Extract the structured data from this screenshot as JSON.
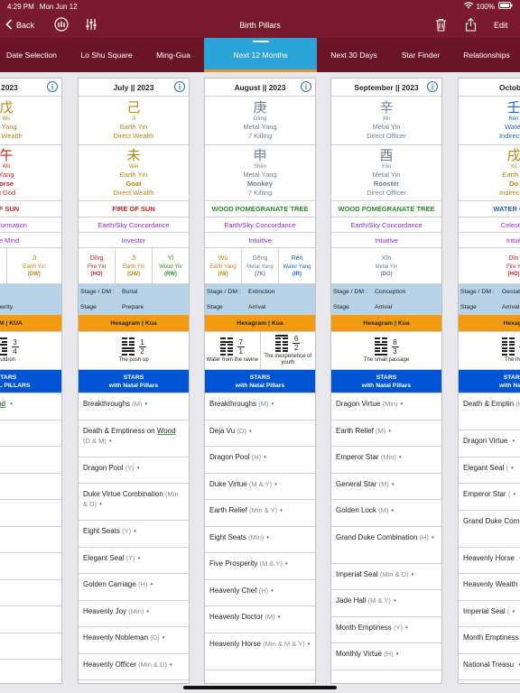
{
  "status": {
    "time": "4:29 PM",
    "date": "Mon Jun 12",
    "battery": "100%"
  },
  "nav": {
    "back": "Back",
    "title": "Birth Pillars",
    "edit": "Edit"
  },
  "tabs": [
    {
      "label": "Date Selection",
      "active": false
    },
    {
      "label": "Lo Shu Square",
      "active": false
    },
    {
      "label": "Ming-Gua",
      "active": false
    },
    {
      "label": "Next 12 Months",
      "active": true
    },
    {
      "label": "Next 30 Days",
      "active": false
    },
    {
      "label": "Star Finder",
      "active": false
    },
    {
      "label": "Relationships",
      "active": false
    }
  ],
  "colors": {
    "nav": "#7a1a2e",
    "tab_active": "#2aa3d9",
    "stage": "#b7d3ea",
    "hexagram": "#f29b10",
    "stars": "#0055d4",
    "fire": "#c81e1e",
    "earth": "#b8860b",
    "metal": "#6a7f95",
    "wood": "#2e8b2e",
    "water": "#1e63c8"
  },
  "cards": [
    {
      "month": "|| 2023",
      "stem": {
        "ch": "戊",
        "py": "Wù",
        "l1": "n Yang",
        "l2": "ect Wealth",
        "cls": "c-earth"
      },
      "branch": {
        "ch": "午",
        "py": "Wǔ",
        "l1": "Yang",
        "l2": "orse",
        "l3": "g God",
        "cls": "c-fire"
      },
      "nayin": "OF SUN",
      "nayin_cls": "c-fire",
      "rel": "ransformation",
      "trait": "ete Mind",
      "hidden": [
        {
          "py": "",
          "l1": "",
          "l2": "",
          "cls": "c-fire"
        },
        {
          "py": "Jǐ",
          "l1": "Earth Yin",
          "l2": "(DW)",
          "cls": "c-earth"
        }
      ],
      "stage": {
        "dm_k": "",
        "dm_v": "th",
        "st_k": "",
        "st_v": "sperity"
      },
      "hex_label": "RAM | KUA",
      "hexes": [
        {
          "top": [
            1,
            0,
            1
          ],
          "bot": [
            0,
            0,
            1
          ],
          "n": "3",
          "d": "4",
          "name": "auldron"
        }
      ],
      "stars_h1": "STARS",
      "stars_h2": "NATAL PILLARS",
      "stars": [
        {
          "t": "tiness on ",
          "t2": "Wood",
          "q": "",
          "two": false
        },
        {
          "t": "",
          "q": "Min)",
          "two": false
        },
        {
          "t": "",
          "q": "H)",
          "two": false
        },
        {
          "t": "",
          "q": "(Min)",
          "two": false
        },
        {
          "t": "e",
          "q": "(M)",
          "two": false
        },
        {
          "t": "",
          "q": "Min)",
          "two": false
        },
        {
          "t": "",
          "q": "(Min)",
          "two": false
        },
        {
          "t": "f",
          "q": "(M & Y)",
          "two": false
        },
        {
          "t": "se",
          "q": "(Min & D)",
          "two": false
        },
        {
          "t": "",
          "q": "(Y)",
          "two": false
        }
      ]
    },
    {
      "month": "July || 2023",
      "stem": {
        "ch": "己",
        "py": "Jǐ",
        "l1": "Earth Yin",
        "l2": "Direct Wealth",
        "cls": "c-earth"
      },
      "branch": {
        "ch": "未",
        "py": "Wèi",
        "l1": "Earth Yin",
        "l2": "Goat",
        "l3": "Direct Wealth",
        "cls": "c-earth"
      },
      "nayin": "FIRE OF SUN",
      "nayin_cls": "c-fire",
      "rel": "Earth/Sky Concordance",
      "trait": "Investor",
      "hidden": [
        {
          "py": "Dīng",
          "l1": "Fire Yin",
          "l2": "(HO)",
          "cls": "c-fire"
        },
        {
          "py": "Jǐ",
          "l1": "Earth Yin",
          "l2": "(DW)",
          "cls": "c-earth"
        },
        {
          "py": "Yǐ",
          "l1": "Wood Yin",
          "l2": "(RW)",
          "cls": "c-wood"
        }
      ],
      "stage": {
        "dm_k": "Stage / DM :",
        "dm_v": "Burial",
        "st_k": "Stage",
        "st_v": "Prepare"
      },
      "hex_label": "Hexagram | Kua",
      "hexes": [
        {
          "top": [
            0,
            0,
            0
          ],
          "bot": [
            1,
            1,
            0
          ],
          "n": "1",
          "d": "2",
          "name": "The push up"
        }
      ],
      "stars_h1": "STARS",
      "stars_h2": "with Natal Pillars",
      "stars": [
        {
          "t": "Breakthroughs",
          "q": "(M)",
          "two": false
        },
        {
          "t": "Death & Emptiness on ",
          "t2": "Wood",
          "q": "(D & M)",
          "two": true
        },
        {
          "t": "Dragon Pool",
          "q": "(Y)",
          "two": false
        },
        {
          "t": "Duke Virtue Combination",
          "q": "(Min & D)",
          "two": true
        },
        {
          "t": "Eight Seats",
          "q": "(Y)",
          "two": false
        },
        {
          "t": "Elegant Seal",
          "q": "(Y)",
          "two": false
        },
        {
          "t": "Golden Carriage",
          "q": "(H)",
          "two": false
        },
        {
          "t": "Heavenly Joy",
          "q": "(Min)",
          "two": false
        },
        {
          "t": "Heavenly Nobleman",
          "q": "(D)",
          "two": false
        },
        {
          "t": "Heavenly Officer",
          "q": "(Min & D)",
          "two": false
        }
      ]
    },
    {
      "month": "August || 2023",
      "stem": {
        "ch": "庚",
        "py": "Gēng",
        "l1": "Metal Yang",
        "l2": "7 Killing",
        "cls": "c-metal"
      },
      "branch": {
        "ch": "申",
        "py": "Shēn",
        "l1": "Metal Yang",
        "l2": "Monkey",
        "l3": "7 Killing",
        "cls": "c-metal"
      },
      "nayin": "WOOD POMEGRANATE TREE",
      "nayin_cls": "c-wood",
      "rel": "Earth/Sky Concordance",
      "trait": "Intuitive",
      "hidden": [
        {
          "py": "Wù",
          "l1": "Earth Yang",
          "l2": "(IW)",
          "cls": "c-earth"
        },
        {
          "py": "Gēng",
          "l1": "Metal Yang",
          "l2": "(7K)",
          "cls": "c-metal"
        },
        {
          "py": "Rén",
          "l1": "Water Yang",
          "l2": "(IR)",
          "cls": "c-water"
        }
      ],
      "stage": {
        "dm_k": "Stage / DM :",
        "dm_v": "Extinction",
        "st_k": "Stage",
        "st_v": "Arrival"
      },
      "hex_label": "Hexagram | Kua",
      "hexes": [
        {
          "top": [
            0,
            1,
            0
          ],
          "bot": [
            0,
            0,
            0
          ],
          "n": "7",
          "d": "1",
          "name": "Water from the ravine"
        },
        {
          "top": [
            1,
            0,
            0
          ],
          "bot": [
            0,
            0,
            0
          ],
          "n": "6",
          "d": "2",
          "name": "The inexperience of youth"
        }
      ],
      "stars_h1": "STARS",
      "stars_h2": "with Natal Pillars",
      "stars": [
        {
          "t": "Breakthroughs",
          "q": "(M)",
          "two": false
        },
        {
          "t": "Deja Vu",
          "q": "(D)",
          "two": false
        },
        {
          "t": "Dragon Pool",
          "q": "(H)",
          "two": false
        },
        {
          "t": "Duke Virtue",
          "q": "(M & Y)",
          "two": false
        },
        {
          "t": "Earth Relief",
          "q": "(Min & Y)",
          "two": false
        },
        {
          "t": "Eight Seats",
          "q": "(Min)",
          "two": false
        },
        {
          "t": "Five Prosperity",
          "q": "(M & Y)",
          "two": false
        },
        {
          "t": "Heavenly Chef",
          "q": "(H)",
          "two": false
        },
        {
          "t": "Heavenly Doctor",
          "q": "(M)",
          "two": false
        },
        {
          "t": "Heavenly Horse",
          "q": "(Min & M & Y)",
          "two": true
        }
      ]
    },
    {
      "month": "September || 2023",
      "stem": {
        "ch": "辛",
        "py": "Xīn",
        "l1": "Metal Yin",
        "l2": "Direct Officer",
        "cls": "c-metal"
      },
      "branch": {
        "ch": "酉",
        "py": "Yǒu",
        "l1": "Metal Yin",
        "l2": "Rooster",
        "l3": "Direct Officer",
        "cls": "c-metal"
      },
      "nayin": "WOOD POMEGRANATE TREE",
      "nayin_cls": "c-wood",
      "rel": "Earth/Sky Concordance",
      "trait": "Intuitive",
      "hidden": [
        {
          "py": "Xīn",
          "l1": "Metal Yin",
          "l2": "(DO)",
          "cls": "c-metal"
        }
      ],
      "stage": {
        "dm_k": "Stage / DM :",
        "dm_v": "Conception",
        "st_k": "Stage",
        "st_v": "Arrival"
      },
      "hex_label": "Hexagram | Kua",
      "hexes": [
        {
          "top": [
            0,
            0,
            1
          ],
          "bot": [
            0,
            0,
            1
          ],
          "n": "8",
          "d": "3",
          "name": "The small passage"
        }
      ],
      "stars_h1": "STARS",
      "stars_h2": "with Natal Pillars",
      "stars": [
        {
          "t": "Dragon Virtue",
          "q": "(Min)",
          "two": false
        },
        {
          "t": "Earth Relief",
          "q": "(M)",
          "two": false
        },
        {
          "t": "Emperor Star",
          "q": "(Min)",
          "two": false
        },
        {
          "t": "General Star",
          "q": "(M)",
          "two": false
        },
        {
          "t": "Golden Lock",
          "q": "(M)",
          "two": false
        },
        {
          "t": "Grand Duke Combination",
          "q": "(H)",
          "two": true
        },
        {
          "t": "Imperial Seal",
          "q": "(Min & D)",
          "two": false
        },
        {
          "t": "Jade Hall",
          "q": "(M & Y)",
          "two": false
        },
        {
          "t": "Month Emptiness",
          "q": "(Y)",
          "two": false
        },
        {
          "t": "Monthly Virtue",
          "q": "(H)",
          "two": false
        }
      ]
    },
    {
      "month": "October",
      "stem": {
        "ch": "壬",
        "py": "Rén",
        "l1": "Water",
        "l2": "Indirect R",
        "cls": "c-water"
      },
      "branch": {
        "ch": "戌",
        "py": "Xū",
        "l1": "Earth Y",
        "l2": "Do",
        "l3": "Indirect V",
        "cls": "c-earth"
      },
      "nayin": "WATER GRA",
      "nayin_cls": "c-water",
      "rel": "Celestial",
      "trait": "Intuit",
      "hidden": [
        {
          "py": "Dīn",
          "l1": "Fire Y",
          "l2": "(HO)",
          "cls": "c-fire"
        }
      ],
      "stage": {
        "dm_k": "Stage / DM :",
        "dm_v": "Gestat",
        "st_k": "Stage",
        "st_v": "Arrival"
      },
      "hex_label": "Hexagr",
      "hexes": [
        {
          "top": [
            0,
            0,
            0
          ],
          "bot": [
            0,
            0,
            0
          ],
          "n": "",
          "d": "",
          "name": "The me"
        }
      ],
      "stars_h1": "STARS",
      "stars_h2": "with Natal",
      "stars": [
        {
          "t": "Death & Emptin",
          "q": "(H)",
          "two": true
        },
        {
          "t": "Dragon Virtue",
          "q": "",
          "two": false
        },
        {
          "t": "Elegant Seal",
          "q": "(",
          "two": false
        },
        {
          "t": "Emperor Star",
          "q": "(",
          "two": false
        },
        {
          "t": "Grand Duke Com",
          "q": "",
          "two": true
        },
        {
          "t": "Heavenly Horse",
          "q": "",
          "two": false
        },
        {
          "t": "Heavenly Wealth",
          "q": "",
          "two": false
        },
        {
          "t": "Imperial Seal",
          "q": "(",
          "two": false
        },
        {
          "t": "Month Emptiness",
          "q": "",
          "two": false
        },
        {
          "t": "National Treasu",
          "q": "",
          "two": false
        }
      ]
    }
  ]
}
